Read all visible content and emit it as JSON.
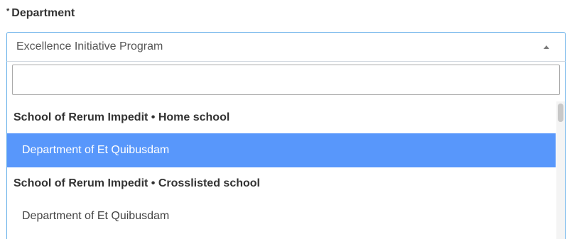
{
  "field": {
    "required_mark": "*",
    "label": "Department"
  },
  "select": {
    "value": "Excellence Initiative Program"
  },
  "search": {
    "value": "",
    "placeholder": ""
  },
  "groups": [
    {
      "header": "School of Rerum Impedit • Home school",
      "options": [
        {
          "label": "Department of Et Quibusdam",
          "highlighted": true
        }
      ]
    },
    {
      "header": "School of Rerum Impedit • Crosslisted school",
      "options": [
        {
          "label": "Department of Et Quibusdam",
          "highlighted": false
        }
      ]
    }
  ],
  "colors": {
    "highlight": "#5897fb",
    "focus_border": "#66afe9"
  },
  "icons": {
    "caret": "caret-up-icon",
    "scroll": "scrollbar-thumb"
  }
}
